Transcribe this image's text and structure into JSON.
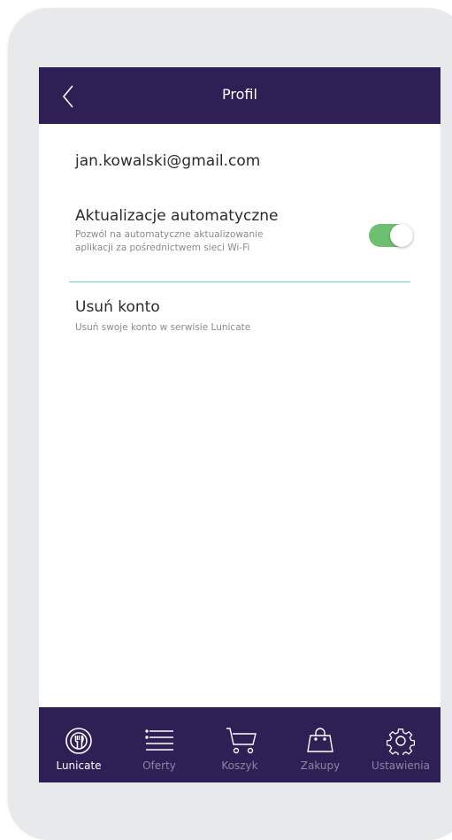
{
  "header": {
    "title": "Profil",
    "back_icon": "chevron-left-icon"
  },
  "account": {
    "email": "jan.kowalski@gmail.com"
  },
  "settings": [
    {
      "title": "Aktualizacje automatyczne",
      "description_line1": "Pozwól na automatyczne aktualizowanie",
      "description_line2": "aplikacji za pośrednictwem sieci Wi-Fi",
      "toggle_on": true
    },
    {
      "title": "Usuń konto",
      "description": "Usuń swoje konto w serwisie Lunicate"
    }
  ],
  "bottom_nav": {
    "items": [
      {
        "label": "Lunicate",
        "icon": "lunicate-logo-icon",
        "active": true
      },
      {
        "label": "Oferty",
        "icon": "list-icon",
        "active": false
      },
      {
        "label": "Koszyk",
        "icon": "cart-icon",
        "active": false
      },
      {
        "label": "Zakupy",
        "icon": "shopping-bag-icon",
        "active": false
      },
      {
        "label": "Ustawienia",
        "icon": "gear-icon",
        "active": false
      }
    ]
  },
  "colors": {
    "header_bg": "#2e1f55",
    "toggle_on": "#6cc070",
    "divider": "#6fd3c2",
    "nav_inactive": "#8c85a5"
  }
}
